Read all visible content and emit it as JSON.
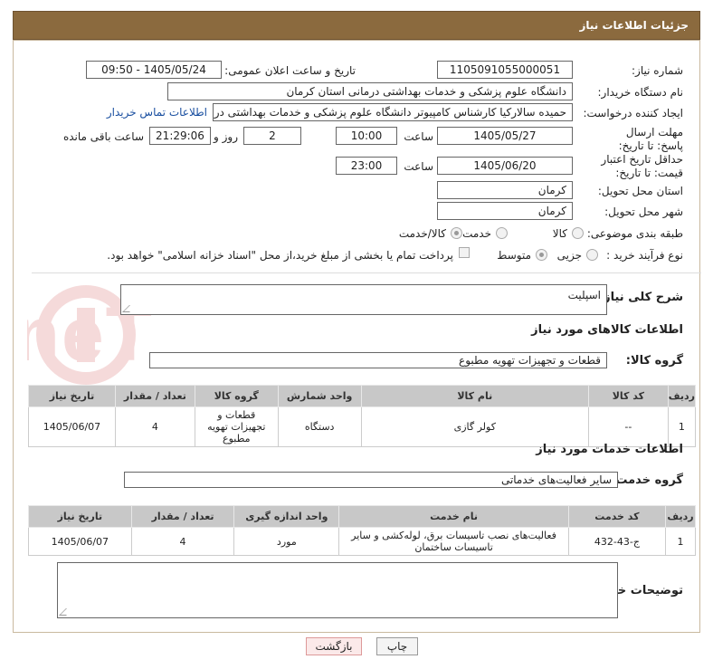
{
  "page": {
    "title": "جزئیات اطلاعات نیاز"
  },
  "fields": {
    "need_number_label": "شماره نیاز:",
    "need_number": "1105091055000051",
    "announce_label": "تاریخ و ساعت اعلان عمومی:",
    "announce_value": "1405/05/24 - 09:50",
    "buyer_org_label": "نام دستگاه خریدار:",
    "buyer_org": "دانشگاه علوم پزشکی و خدمات بهداشتی درمانی استان کرمان",
    "creator_label": "ایجاد کننده درخواست:",
    "creator": "حمیده سالارکیا کارشناس کامپیوتر دانشگاه علوم پزشکی و خدمات بهداشتی در",
    "contact_link": "اطلاعات تماس خریدار",
    "deadline_label": "مهلت ارسال پاسخ: تا تاریخ:",
    "deadline_date": "1405/05/27",
    "time_label": "ساعت",
    "deadline_time": "10:00",
    "days": "2",
    "days_label": "روز و",
    "remaining": "21:29:06",
    "remaining_label": "ساعت باقی مانده",
    "validity_label": "حداقل تاریخ اعتبار قیمت: تا تاریخ:",
    "validity_date": "1405/06/20",
    "validity_time": "23:00",
    "province_label": "استان محل تحویل:",
    "province": "کرمان",
    "city_label": "شهر محل تحویل:",
    "city": "کرمان",
    "category_label": "طبقه بندی موضوعی:",
    "category_options": [
      "کالا",
      "خدمت",
      "کالا/خدمت"
    ],
    "process_label": "نوع فرآیند خرید :",
    "process_options": [
      "جزیی",
      "متوسط"
    ],
    "payment_note": "پرداخت تمام یا بخشی از مبلغ خرید،از محل \"اسناد خزانه اسلامی\" خواهد بود."
  },
  "description": {
    "label": "شرح کلی نیاز:",
    "value": "اسپلیت"
  },
  "goods": {
    "section_title": "اطلاعات کالاهای مورد نیاز",
    "group_label": "گروه کالا:",
    "group_value": "قطعات و تجهیزات تهویه مطبوع",
    "columns": [
      "ردیف",
      "کد کالا",
      "نام کالا",
      "واحد شمارش",
      "گروه کالا",
      "تعداد / مقدار",
      "تاریخ نیاز"
    ],
    "rows": [
      [
        "1",
        "--",
        "کولر گازی",
        "دستگاه",
        "قطعات و تجهیزات تهویه مطبوع",
        "4",
        "1405/06/07"
      ]
    ]
  },
  "services": {
    "section_title": "اطلاعات خدمات مورد نیاز",
    "group_label": "گروه خدمت:",
    "group_value": "سایر فعالیت‌های خدماتی",
    "columns": [
      "ردیف",
      "کد خدمت",
      "نام خدمت",
      "واحد اندازه گیری",
      "تعداد / مقدار",
      "تاریخ نیاز"
    ],
    "rows": [
      [
        "1",
        "ج-43-432",
        "فعالیت‌های نصب تاسیسات برق، لوله‌کشی و سایر تاسیسات ساختمان",
        "مورد",
        "4",
        "1405/06/07"
      ]
    ]
  },
  "buyer_notes": {
    "label": "توضیحات خریدار:",
    "value": ""
  },
  "buttons": {
    "print": "چاپ",
    "back": "بازگشت"
  },
  "watermark": {
    "text": "AriaTender.neT"
  },
  "colors": {
    "header": "#8b6a3e",
    "table_header": "#c8c8c8",
    "link": "#1a4fa0"
  }
}
